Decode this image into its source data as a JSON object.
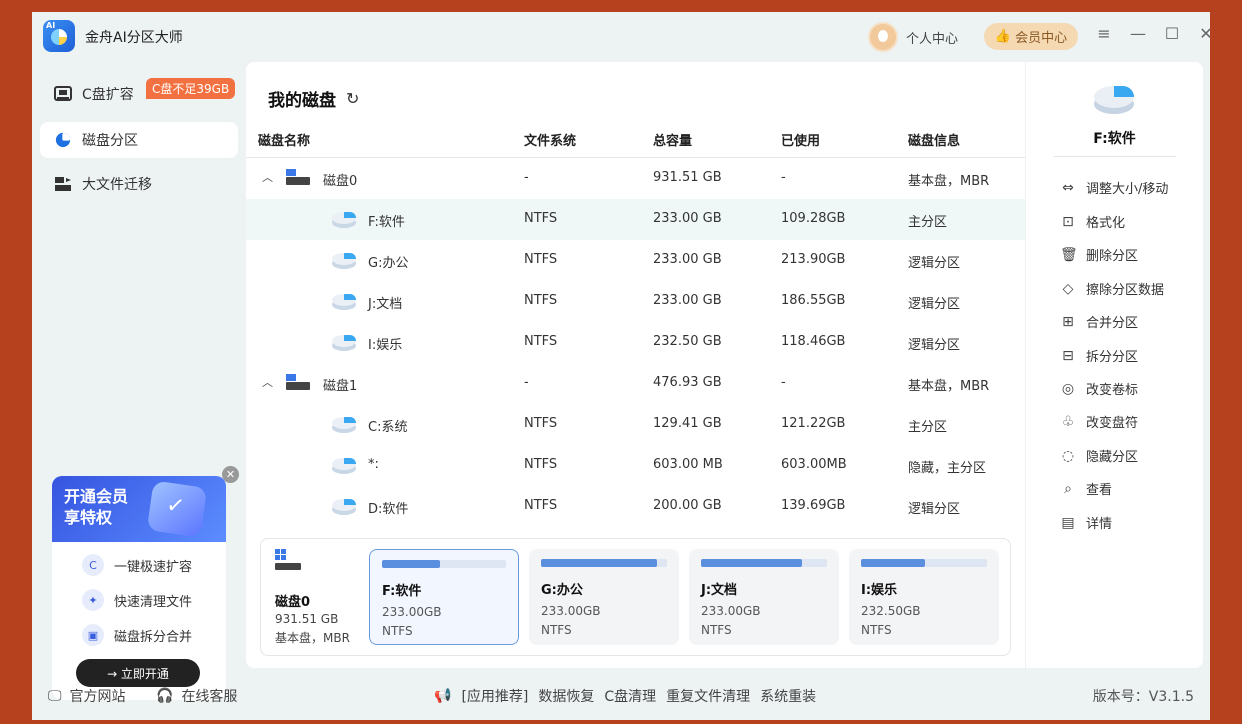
{
  "app": {
    "title": "金舟AI分区大师",
    "logo_badge": "AI",
    "user_center": "个人中心",
    "member_center": "会员中心",
    "window_controls": [
      "≡",
      "—",
      "☐",
      "✕"
    ]
  },
  "sidebar": {
    "items": [
      {
        "label": "C盘扩容",
        "icon": "c-drive-icon"
      },
      {
        "label": "磁盘分区",
        "icon": "pie-icon"
      },
      {
        "label": "大文件迁移",
        "icon": "migrate-icon"
      }
    ],
    "warning_badge": "C盘不足39GB"
  },
  "promo": {
    "title_line1": "开通会员",
    "title_line2": "享特权",
    "items": [
      "一键极速扩容",
      "快速清理文件",
      "磁盘拆分合并"
    ],
    "cta": "→ 立即开通"
  },
  "main": {
    "title": "我的磁盘",
    "columns": [
      "磁盘名称",
      "文件系统",
      "总容量",
      "已使用",
      "磁盘信息"
    ],
    "rows": [
      {
        "kind": "disk",
        "name": "磁盘0",
        "fs": "-",
        "total": "931.51 GB",
        "used": "-",
        "info": "基本盘，MBR"
      },
      {
        "kind": "part",
        "name": "F:软件",
        "fs": "NTFS",
        "total": "233.00 GB",
        "used": "109.28GB",
        "info": "主分区",
        "selected": true
      },
      {
        "kind": "part",
        "name": "G:办公",
        "fs": "NTFS",
        "total": "233.00 GB",
        "used": "213.90GB",
        "info": "逻辑分区"
      },
      {
        "kind": "part",
        "name": "J:文档",
        "fs": "NTFS",
        "total": "233.00 GB",
        "used": "186.55GB",
        "info": "逻辑分区"
      },
      {
        "kind": "part",
        "name": "I:娱乐",
        "fs": "NTFS",
        "total": "232.50 GB",
        "used": "118.46GB",
        "info": "逻辑分区"
      },
      {
        "kind": "disk",
        "name": "磁盘1",
        "fs": "-",
        "total": "476.93 GB",
        "used": "-",
        "info": "基本盘，MBR"
      },
      {
        "kind": "part",
        "name": "C:系统",
        "fs": "NTFS",
        "total": "129.41 GB",
        "used": "121.22GB",
        "info": "主分区"
      },
      {
        "kind": "part",
        "name": "*:",
        "fs": "NTFS",
        "total": "603.00 MB",
        "used": "603.00MB",
        "info": "隐藏，主分区"
      },
      {
        "kind": "part",
        "name": "D:软件",
        "fs": "NTFS",
        "total": "200.00 GB",
        "used": "139.69GB",
        "info": "逻辑分区"
      }
    ]
  },
  "diskmap": {
    "disk": {
      "name": "磁盘0",
      "size": "931.51 GB",
      "info": "基本盘，MBR"
    },
    "partitions": [
      {
        "name": "F:软件",
        "size": "233.00GB",
        "fs": "NTFS",
        "usage": 0.47,
        "active": true
      },
      {
        "name": "G:办公",
        "size": "233.00GB",
        "fs": "NTFS",
        "usage": 0.92
      },
      {
        "name": "J:文档",
        "size": "233.00GB",
        "fs": "NTFS",
        "usage": 0.8
      },
      {
        "name": "I:娱乐",
        "size": "232.50GB",
        "fs": "NTFS",
        "usage": 0.51
      }
    ]
  },
  "right_panel": {
    "title": "F:软件",
    "actions": [
      {
        "label": "调整大小/移动",
        "icon": "⇔"
      },
      {
        "label": "格式化",
        "icon": "⊡"
      },
      {
        "label": "删除分区",
        "icon": "🗑"
      },
      {
        "label": "擦除分区数据",
        "icon": "◇"
      },
      {
        "label": "合并分区",
        "icon": "⊞"
      },
      {
        "label": "拆分分区",
        "icon": "⊟"
      },
      {
        "label": "改变卷标",
        "icon": "◎"
      },
      {
        "label": "改变盘符",
        "icon": "♧"
      },
      {
        "label": "隐藏分区",
        "icon": "◌"
      },
      {
        "label": "查看",
        "icon": "⌕"
      },
      {
        "label": "详情",
        "icon": "▤"
      }
    ]
  },
  "footer": {
    "website": "官方网站",
    "support": "在线客服",
    "recommend_prefix": "[应用推荐]",
    "recommend_links": [
      "数据恢复",
      "C盘清理",
      "重复文件清理",
      "系统重装"
    ],
    "version": "版本号：V3.1.5"
  }
}
